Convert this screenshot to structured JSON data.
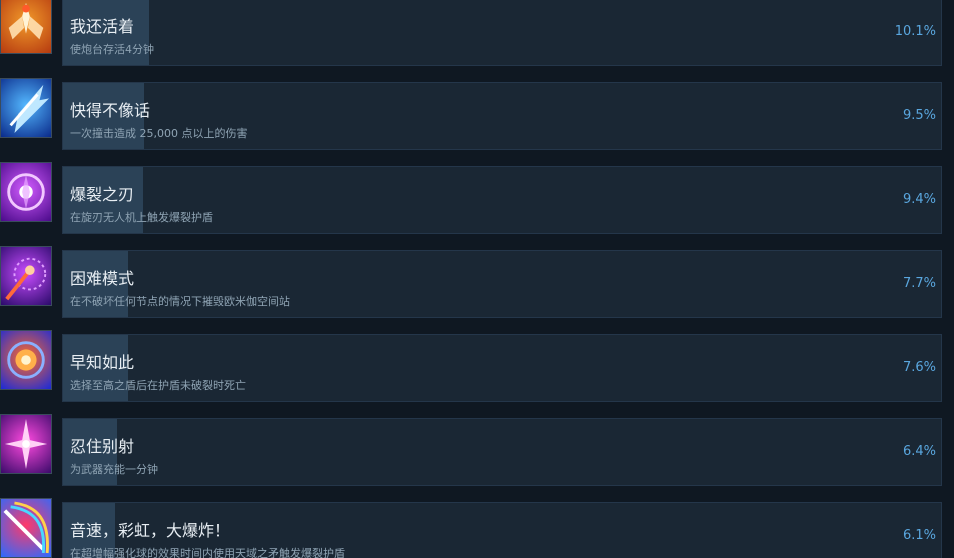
{
  "achievements": [
    {
      "title": "我还活着",
      "description": "使炮台存活4分钟",
      "percent": "10.1%",
      "unlock_rate": 0.101,
      "icon": "winged-figure-icon",
      "colors": [
        "#f29a2a",
        "#b53a10"
      ]
    },
    {
      "title": "快得不像话",
      "description": "一次撞击造成 25,000 点以上的伤害",
      "percent": "9.5%",
      "unlock_rate": 0.095,
      "icon": "speed-blade-icon",
      "colors": [
        "#54b8ff",
        "#0a2a8a"
      ]
    },
    {
      "title": "爆裂之刃",
      "description": "在旋刃无人机上触发爆裂护盾",
      "percent": "9.4%",
      "unlock_rate": 0.094,
      "icon": "buzzsaw-drone-icon",
      "colors": [
        "#d25cff",
        "#4a0a8a"
      ]
    },
    {
      "title": "困难模式",
      "description": "在不破坏任何节点的情况下摧毁欧米伽空间站",
      "percent": "7.7%",
      "unlock_rate": 0.077,
      "icon": "station-burst-icon",
      "colors": [
        "#c84cff",
        "#2a0a6a"
      ]
    },
    {
      "title": "早知如此",
      "description": "选择至高之盾后在护盾未破裂时死亡",
      "percent": "7.6%",
      "unlock_rate": 0.076,
      "icon": "glowing-shield-orb-icon",
      "colors": [
        "#ff6a2a",
        "#1a2ad8"
      ]
    },
    {
      "title": "忍住别射",
      "description": "为武器充能一分钟",
      "percent": "6.4%",
      "unlock_rate": 0.064,
      "icon": "charge-spark-icon",
      "colors": [
        "#ff4ae0",
        "#3a0a6a"
      ]
    },
    {
      "title": "音速，彩虹，大爆炸！",
      "description": "在超增幅强化球的效果时间内使用天域之矛触发爆裂护盾",
      "percent": "6.1%",
      "unlock_rate": 0.061,
      "icon": "rainbow-spear-icon",
      "colors": [
        "#ff3a6a",
        "#2a6aff"
      ]
    }
  ]
}
